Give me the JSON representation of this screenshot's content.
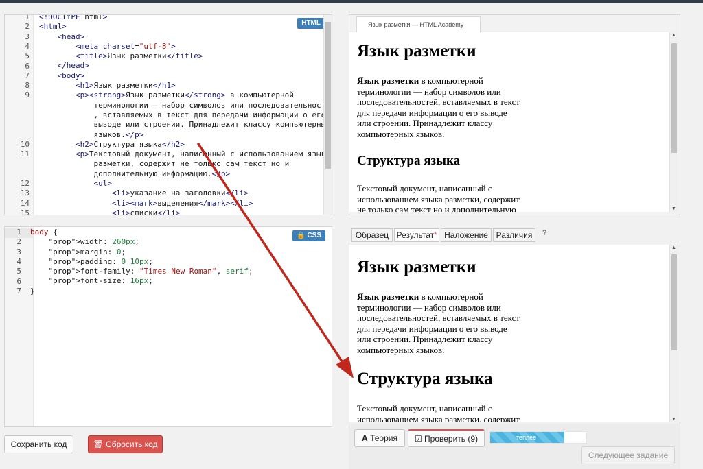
{
  "html_editor": {
    "badge": "HTML",
    "line_numbers": [
      "1",
      "2",
      "3",
      "4",
      "5",
      "6",
      "7",
      "8",
      "9",
      "",
      "",
      "",
      "",
      "10",
      "11",
      "",
      "",
      "12",
      "13",
      "14",
      "15"
    ],
    "lines": [
      "<!DOCTYPE html>",
      "<html>",
      "    <head>",
      "        <meta charset=\"utf-8\">",
      "        <title>Язык разметки</title>",
      "    </head>",
      "    <body>",
      "        <h1>Язык разметки</h1>",
      "        <p><strong>Язык разметки</strong> в компьютерной",
      "            терминологии — набор символов или последовательностей",
      "            , вставляемых в текст для передачи информации о его",
      "            выводе или строении. Принадлежит классу компьютерных",
      "            языков.</p>",
      "        <h2>Структура языка</h2>",
      "        <p>Текстовый документ, написанный с использованием языка",
      "            разметки, содержит не только сам текст но и",
      "            дополнительную информацию.</p>",
      "            <ul>",
      "                <li>указание на заголовки</li>",
      "                <li><mark>выделения</mark></li>",
      "                <li>списки</li>"
    ]
  },
  "css_editor": {
    "badge": "CSS",
    "line_numbers": [
      "1",
      "2",
      "3",
      "4",
      "5",
      "6",
      "7"
    ],
    "lines": [
      "body {",
      "    width: 260px;",
      "    margin: 0;",
      "    padding: 0 10px;",
      "    font-family: \"Times New Roman\", serif;",
      "    font-size: 16px;",
      "}"
    ]
  },
  "preview": {
    "tab_title": "Язык разметки — HTML Academy",
    "h1": "Язык разметки",
    "p1_strong": "Язык разметки",
    "p1_rest": " в компьютерной терминологии — набор символов или последовательностей, вставляемых в текст для передачи информации о его выводе или строении. Принадлежит классу компьютерных языков.",
    "h2": "Структура языка",
    "p2": "Текстовый документ, написанный с использованием языка разметки, содержит не только сам текст но и дополнительную информацию."
  },
  "compare": {
    "tabs": [
      "Образец",
      "Результат",
      "Наложение",
      "Различия",
      "?"
    ],
    "active_tab": "Результат",
    "modified_mark": "*",
    "h1": "Язык разметки",
    "p1_strong": "Язык разметки",
    "p1_rest": " в компьютерной терминологии — набор символов или последовательностей, вставляемых в текст для передачи информации о его выводе или строении. Принадлежит классу компьютерных языков.",
    "h2": "Структура языка",
    "p2": "Текстовый документ, написанный с использованием языка разметки, содержит не только сам текст но и"
  },
  "actions": {
    "save": "Сохранить код",
    "reset": "Сбросить код",
    "theory": "Теория",
    "check": "Проверить (9)",
    "progress_label": "теплее",
    "progress_value": 0.77,
    "next": "Следующее задание"
  },
  "colors": {
    "html_badge": "#3d7fb6",
    "css_badge": "#3d7fb6",
    "reset": "#d9534f",
    "arrow": "#c0281e",
    "progress": "#4cb4dc"
  }
}
